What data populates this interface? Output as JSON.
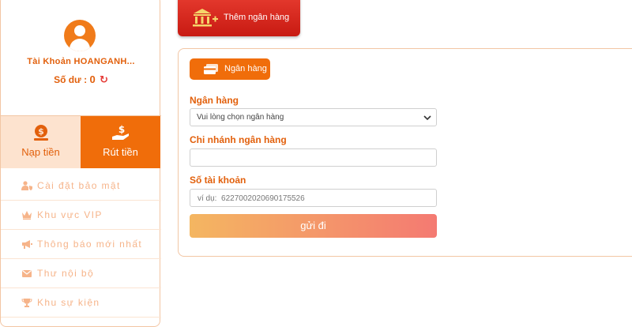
{
  "sidebar": {
    "account_name": "Tài Khoản HOANGANH...",
    "balance_label": "Số dư :",
    "balance_value": "0",
    "tabs": [
      {
        "label": "Nạp tiền",
        "icon": "money-bag-icon"
      },
      {
        "label": "Rút tiền",
        "icon": "hand-money-icon"
      }
    ],
    "menu": [
      {
        "label": "Cài đặt bảo mật",
        "icon": "user-shield-icon"
      },
      {
        "label": "Khu vực VIP",
        "icon": "crown-icon"
      },
      {
        "label": "Thông báo mới nhất",
        "icon": "megaphone-icon"
      },
      {
        "label": "Thư nội bộ",
        "icon": "envelope-icon"
      },
      {
        "label": "Khu sự kiện",
        "icon": "trophy-icon"
      }
    ]
  },
  "add_bank": {
    "label": "Thêm ngân hàng"
  },
  "panel": {
    "tab_label": "Ngân hàng",
    "bank_label": "Ngân hàng",
    "bank_select_value": "Vui lòng chọn ngân hàng",
    "branch_label": "Chi nhánh ngân hàng",
    "branch_value": "",
    "account_label": "Số tài khoản",
    "account_placeholder": "ví dụ:  6227002020690175526",
    "submit_label": "gửi đi"
  },
  "colors": {
    "accent": "#f06d0a",
    "accent_text": "#e2600c",
    "add_button": "#d4241a",
    "menu_text": "#f6b48a"
  }
}
